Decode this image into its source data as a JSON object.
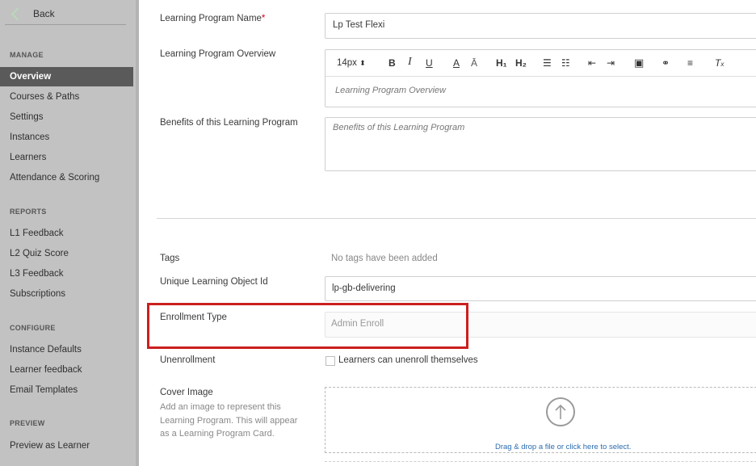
{
  "sidebar": {
    "back_label": "Back",
    "sections": {
      "manage": "MANAGE",
      "reports": "REPORTS",
      "configure": "CONFIGURE",
      "preview": "PREVIEW"
    },
    "manage_items": [
      "Overview",
      "Courses & Paths",
      "Settings",
      "Instances",
      "Learners",
      "Attendance & Scoring"
    ],
    "reports_items": [
      "L1 Feedback",
      "L2 Quiz Score",
      "L3 Feedback",
      "Subscriptions"
    ],
    "configure_items": [
      "Instance Defaults",
      "Learner feedback",
      "Email Templates"
    ],
    "preview_items": [
      "Preview as Learner"
    ],
    "active_item": "Overview"
  },
  "form": {
    "program_name_label": "Learning Program Name",
    "program_name_required": "*",
    "program_name_value": "Lp Test Flexi",
    "overview_label": "Learning Program Overview",
    "overview_placeholder": "Learning Program Overview",
    "toolbar": {
      "font_size": "14px",
      "bold": "B",
      "italic": "I",
      "underline": "U",
      "h1": "H₁",
      "h2": "H₂"
    },
    "benefits_label": "Benefits of this Learning Program",
    "benefits_placeholder": "Benefits of this Learning Program",
    "tags_label": "Tags",
    "tags_value": "No tags have been added",
    "uloid_label": "Unique Learning Object Id",
    "uloid_value": "lp-gb-delivering",
    "enrollment_label": "Enrollment Type",
    "enrollment_value": "Admin Enroll",
    "unenrollment_label": "Unenrollment",
    "unenrollment_checkbox_label": "Learners can unenroll themselves",
    "cover_label": "Cover Image",
    "cover_help": "Add an image to represent this Learning Program. This will appear as a Learning Program Card.",
    "dropzone_text": "Drag & drop a file or click here to select."
  },
  "colors": {
    "sidebar_bg": "#c2c2c2",
    "active_bg": "#5a5a5a",
    "highlight": "#cc1f1f",
    "link": "#2b6cb0"
  }
}
